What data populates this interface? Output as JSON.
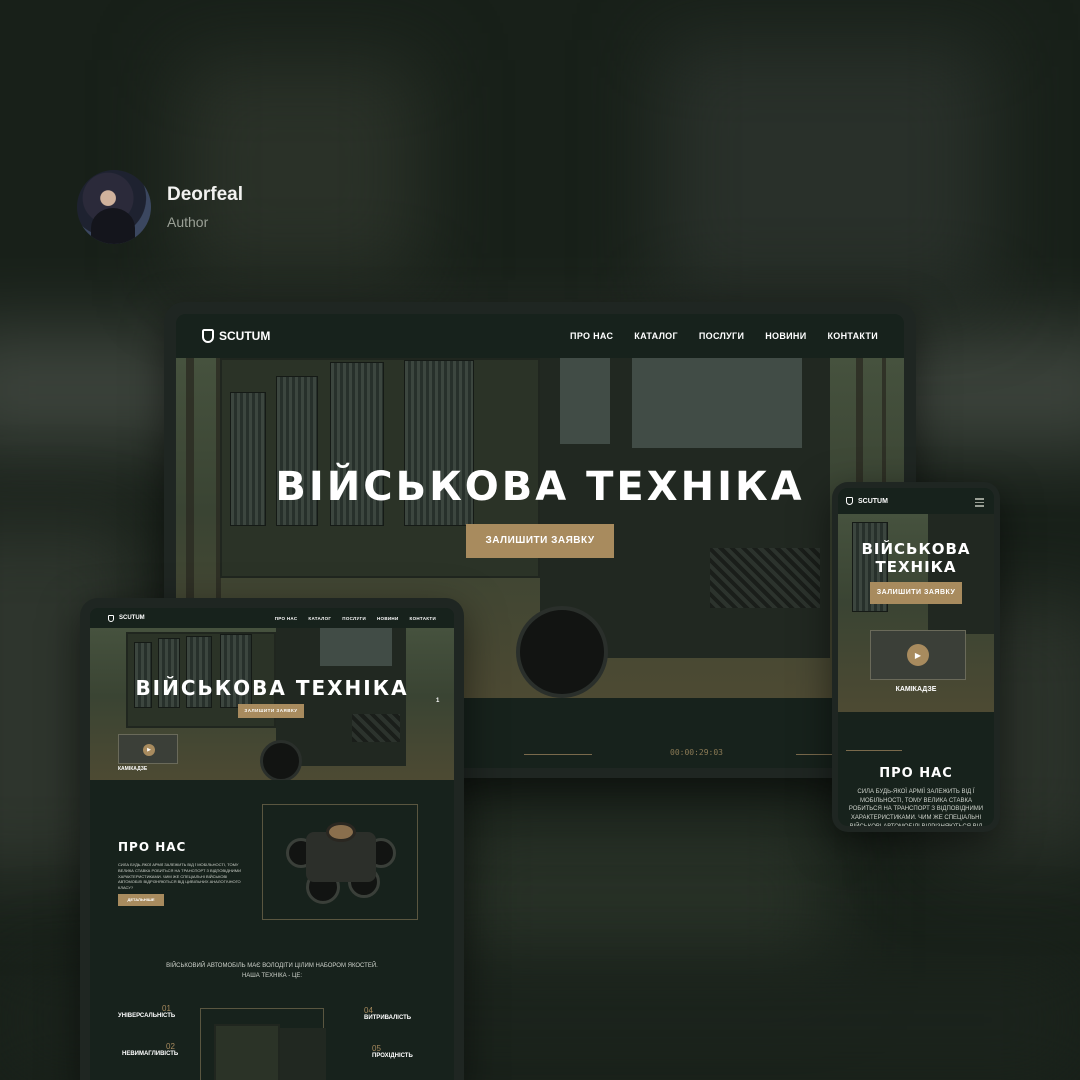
{
  "author": {
    "name": "Deorfeal",
    "role": "Author"
  },
  "brand": {
    "name": "SCUTUM",
    "accent": "#a88b5e",
    "bg": "#17221c"
  },
  "nav": {
    "items": [
      "ПРО НАС",
      "КАТАЛОГ",
      "ПОСЛУГИ",
      "НОВИНИ",
      "КОНТАКТИ"
    ]
  },
  "hero": {
    "title": "ВІЙСЬКОВА ТЕХНІКА",
    "title_line1": "ВІЙСЬКОВА",
    "title_line2": "ТЕХНІКА",
    "cta": "ЗАЛИШИТИ ЗАЯВКУ"
  },
  "video": {
    "timer": "00:00:29:03",
    "caption": "КАМІКАДЗЕ"
  },
  "slider": {
    "counter": "1"
  },
  "about": {
    "title": "ПРО НАС",
    "text": "СИЛА БУДЬ-ЯКОЇ АРМІЇ ЗАЛЕЖИТЬ ВІД Ї МОБІЛЬНОСТІ, ТОМУ ВЕЛИКА СТАВКА РОБИТЬСЯ НА ТРАНСПОРТ З ВІДПОВІДНИМИ ХАРАКТЕРИСТИКАМИ. ЧИМ ЖЕ СПЕЦІАЛЬНІ ВІЙСЬКОВІ АВТОМОБІЛІ ВІДРІЗНЯЮТЬСЯ ВІД ЦИВІЛЬНИХ АНАЛОГІЧНОГО КЛАСУ?",
    "button": "ДЕТАЛЬНІШЕ"
  },
  "qualities": {
    "heading_line1": "ВІЙСЬКОВИЙ АВТОМОБІЛЬ МАЄ ВОЛОДІТИ ЦІЛИМ НАБОРОМ ЯКОСТЕЙ.",
    "heading_line2": "НАША ТЕХНІКА - ЦЕ:",
    "items": [
      {
        "num": "01",
        "title": "УНІВЕРСАЛЬНІСТЬ"
      },
      {
        "num": "02",
        "title": "НЕВИМАГЛИВІСТЬ"
      },
      {
        "num": "04",
        "title": "ВИТРИВАЛІСТЬ"
      },
      {
        "num": "05",
        "title": "ПРОХІДНІСТЬ"
      }
    ]
  }
}
